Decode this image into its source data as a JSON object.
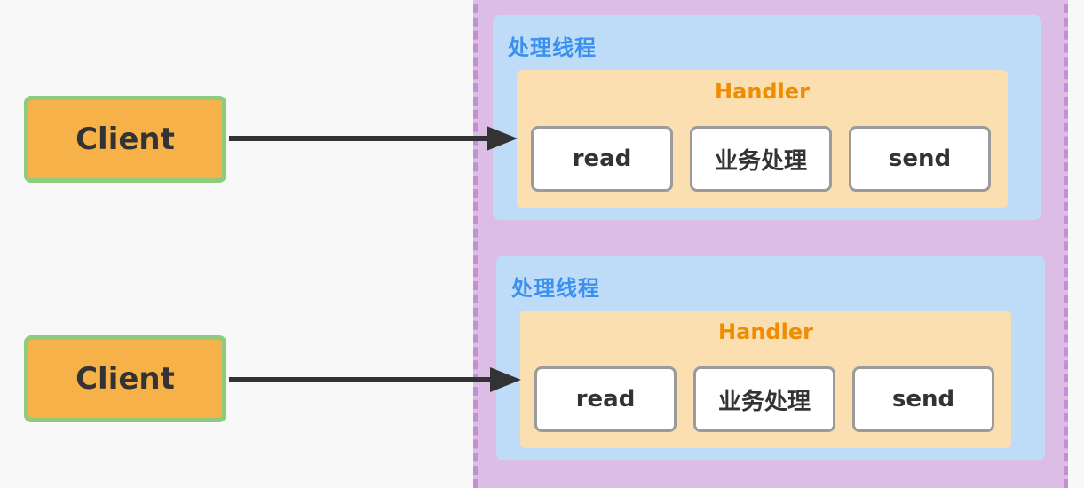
{
  "threads": [
    {
      "title": "处理线程",
      "handler": {
        "title": "Handler",
        "steps": [
          "read",
          "业务处理",
          "send"
        ]
      },
      "client": "Client"
    },
    {
      "title": "处理线程",
      "handler": {
        "title": "Handler",
        "steps": [
          "read",
          "业务处理",
          "send"
        ]
      },
      "client": "Client"
    }
  ],
  "colors": {
    "background": "#f8f8f8",
    "server_area": "#dcbde6",
    "thread_box": "#bedcf7",
    "thread_title": "#3a8ff0",
    "handler_box": "#fbdfb1",
    "handler_title": "#f08c00",
    "client_fill": "#f6b249",
    "client_border": "#8fcb7e",
    "arrow": "#333333"
  }
}
